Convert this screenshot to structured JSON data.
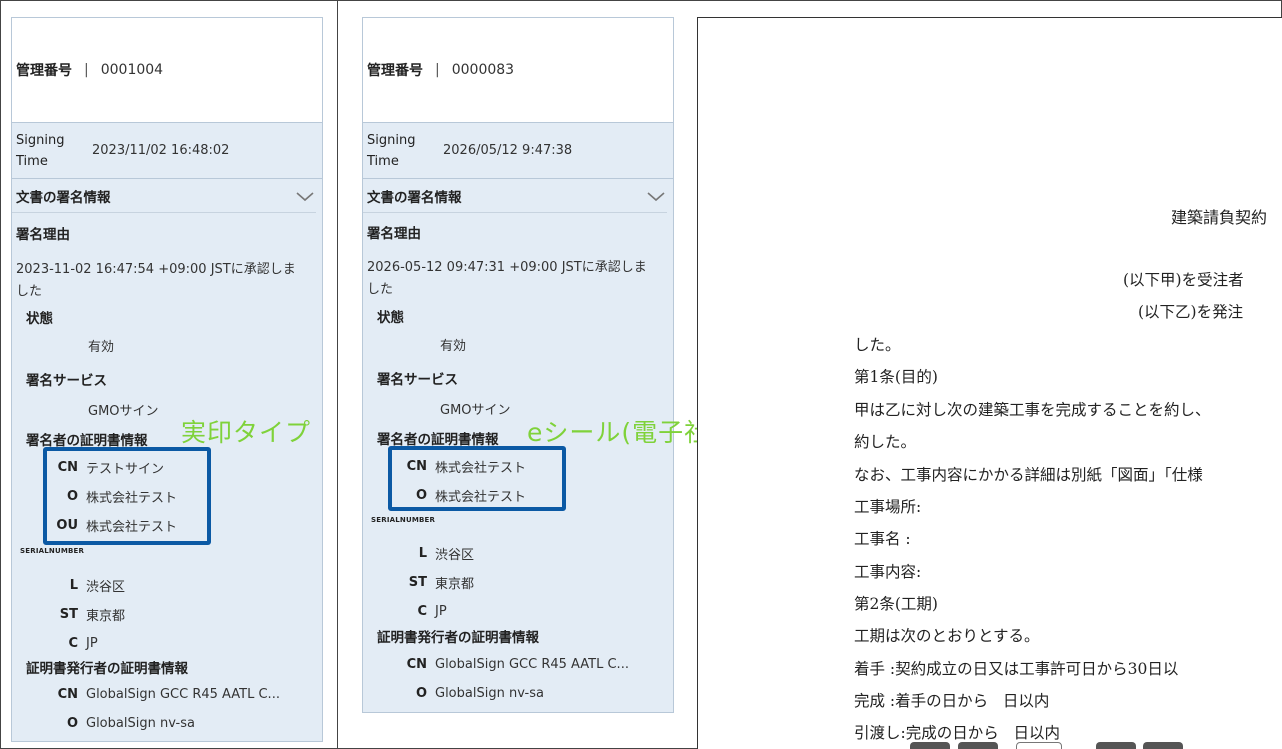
{
  "left_panel": {
    "mgmt_label": "管理番号",
    "mgmt_sep": "|",
    "mgmt_value": "0001004",
    "signing_time_label_1": "Signing",
    "signing_time_label_2": "Time",
    "signing_time_value": "2023/11/02 16:48:02",
    "section_title": "文書の署名情報",
    "reason_title": "署名理由",
    "reason_line1": "2023-11-02 16:47:54 +09:00 JSTに承認しま",
    "reason_line2": "した",
    "status_title": "状態",
    "status_value": "有効",
    "service_title": "署名サービス",
    "service_value": "GMOサイン",
    "signer_cert_title": "署名者の証明書情報",
    "signer_cert": [
      {
        "key": "CN",
        "value": "テストサイン"
      },
      {
        "key": "O",
        "value": "株式会社テスト"
      },
      {
        "key": "OU",
        "value": "株式会社テスト"
      }
    ],
    "serial_label": "SERIALNUMBER",
    "location": [
      {
        "key": "L",
        "value": "渋谷区"
      },
      {
        "key": "ST",
        "value": "東京都"
      },
      {
        "key": "C",
        "value": "JP"
      }
    ],
    "issuer_title": "証明書発行者の証明書情報",
    "issuer": [
      {
        "key": "CN",
        "value": "GlobalSign GCC R45 AATL C..."
      },
      {
        "key": "O",
        "value": "GlobalSign nv-sa"
      }
    ],
    "annotation": "実印タイプ"
  },
  "middle_panel": {
    "mgmt_label": "管理番号",
    "mgmt_sep": "|",
    "mgmt_value": "0000083",
    "signing_time_label_1": "Signing",
    "signing_time_label_2": "Time",
    "signing_time_value": "2026/05/12 9:47:38",
    "section_title": "文書の署名情報",
    "reason_title": "署名理由",
    "reason_line1": "2026-05-12 09:47:31 +09:00 JSTに承認しま",
    "reason_line2": "した",
    "status_title": "状態",
    "status_value": "有効",
    "service_title": "署名サービス",
    "service_value": "GMOサイン",
    "signer_cert_title": "署名者の証明書情報",
    "signer_cert": [
      {
        "key": "CN",
        "value": "株式会社テスト"
      },
      {
        "key": "O",
        "value": "株式会社テスト"
      }
    ],
    "serial_label": "SERIALNUMBER",
    "location": [
      {
        "key": "L",
        "value": "渋谷区"
      },
      {
        "key": "ST",
        "value": "東京都"
      },
      {
        "key": "C",
        "value": "JP"
      }
    ],
    "issuer_title": "証明書発行者の証明書情報",
    "issuer": [
      {
        "key": "CN",
        "value": "GlobalSign GCC R45 AATL C..."
      },
      {
        "key": "O",
        "value": "GlobalSign nv-sa"
      }
    ],
    "annotation": "eシール(電子社印)"
  },
  "document": {
    "title": "建築請負契約",
    "lines": [
      "(以下甲)を受注者",
      "(以下乙)を発注",
      "した。",
      "第1条(目的)",
      "甲は乙に対し次の建築工事を完成することを約し、",
      "約した。",
      "なお、工事内容にかかる詳細は別紙「図面」「仕様",
      "工事場所:",
      "工事名 :",
      "工事内容:",
      "第2条(工期)",
      "工期は次のとおりとする。",
      "着手 :契約成立の日又は工事許可日から30日以",
      "完成 :着手の日から   日以内",
      "引渡し:完成の日から   日以内"
    ]
  }
}
